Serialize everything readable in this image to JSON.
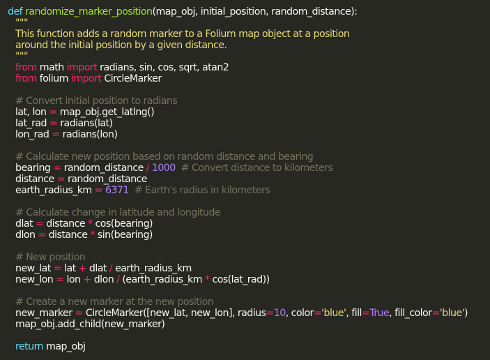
{
  "colors": {
    "background": "#272822",
    "foreground": "#f8f8f2",
    "keyword": "#66d9ef",
    "import_keyword": "#f92672",
    "operator": "#f92672",
    "number": "#ae81ff",
    "string": "#e6db74",
    "function_name": "#a6e22e",
    "comment": "#75715e"
  },
  "code": {
    "l01": {
      "kw": "def",
      "name": "randomize_marker_position",
      "sig": "(map_obj, initial_position, random_distance):"
    },
    "l02": {
      "doc": "\"\"\""
    },
    "l03": {
      "doc": "This function adds a random marker to a Folium map object at a position"
    },
    "l04": {
      "doc": "around the initial position by a given distance."
    },
    "l05": {
      "doc": "\"\"\""
    },
    "l06": {
      "from": "from",
      "mod": "math",
      "import": "import",
      "names": "radians, sin, cos, sqrt, atan2"
    },
    "l07": {
      "from": "from",
      "mod": "folium",
      "import": "import",
      "names": "CircleMarker"
    },
    "l09": {
      "comment": "# Convert initial position to radians"
    },
    "l10": {
      "lhs": "lat, lon",
      "op": "=",
      "rhs": "map_obj.get_latlng()"
    },
    "l11": {
      "lhs": "lat_rad",
      "op": "=",
      "rhs": "radians(lat)"
    },
    "l12": {
      "lhs": "lon_rad",
      "op": "=",
      "rhs": "radians(lon)"
    },
    "l14": {
      "comment": "# Calculate new position based on random distance and bearing"
    },
    "l15": {
      "lhs": "bearing",
      "op": "=",
      "a": "random_distance",
      "op2": "/",
      "num": "1000",
      "comment": "# Convert distance to kilometers"
    },
    "l16": {
      "lhs": "distance",
      "op": "=",
      "rhs": "random_distance"
    },
    "l17": {
      "lhs": "earth_radius_km",
      "op": "=",
      "num": "6371",
      "comment": "# Earth's radius in kilometers"
    },
    "l19": {
      "comment": "# Calculate change in latitude and longitude"
    },
    "l20": {
      "lhs": "dlat",
      "op": "=",
      "a": "distance",
      "op2": "*",
      "b": "cos(bearing)"
    },
    "l21": {
      "lhs": "dlon",
      "op": "=",
      "a": "distance",
      "op2": "*",
      "b": "sin(bearing)"
    },
    "l23": {
      "comment": "# New position"
    },
    "l24": {
      "lhs": "new_lat",
      "op": "=",
      "a": "lat",
      "op2": "+",
      "b": "dlat",
      "op3": "/",
      "c": "earth_radius_km"
    },
    "l25": {
      "lhs": "new_lon",
      "op": "=",
      "a": "lon",
      "op2": "+",
      "b": "dlon",
      "op3": "/",
      "c": "(earth_radius_km",
      "op4": "*",
      "d": "cos(lat_rad))"
    },
    "l27": {
      "comment": "# Create a new marker at the new position"
    },
    "l28": {
      "lhs": "new_marker",
      "op": "=",
      "a": "CircleMarker([new_lat, new_lon], radius",
      "eq1": "=",
      "num": "10",
      "b": ", color",
      "eq2": "=",
      "s1": "'blue'",
      "c": ", fill",
      "eq3": "=",
      "kw": "True",
      "d": ", fill_color",
      "eq4": "=",
      "s2": "'blue'",
      "e": ")"
    },
    "l29": {
      "text": "map_obj.add_child(new_marker)"
    },
    "l31": {
      "kw": "return",
      "text": "map_obj"
    }
  }
}
